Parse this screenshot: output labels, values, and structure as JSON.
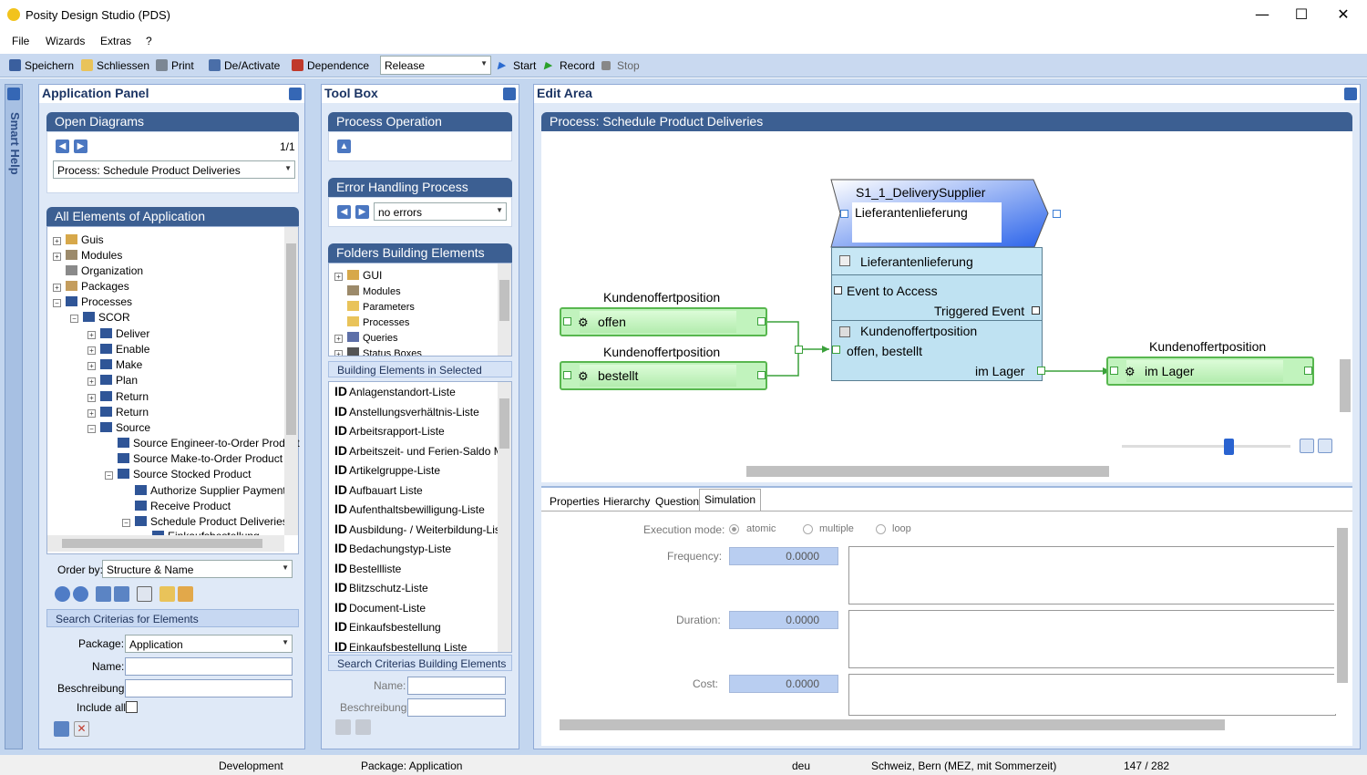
{
  "window": {
    "title": "Posity Design Studio (PDS)",
    "minimize": "—",
    "maximize": "☐",
    "close": "✕"
  },
  "menu": [
    "File",
    "Wizards",
    "Extras",
    "?"
  ],
  "toolbar": {
    "save": "Speichern",
    "close": "Schliessen",
    "print": "Print",
    "activate": "De/Activate",
    "dependence": "Dependence",
    "mode_value": "Release",
    "start": "Start",
    "record": "Record",
    "stop": "Stop"
  },
  "smart_help": "Smart Help",
  "app_panel": {
    "title": "Application Panel",
    "open_diagrams": "Open Diagrams",
    "page": "1/1",
    "diagram_select": "Process: Schedule Product Deliveries",
    "all_elements": "All Elements of Application",
    "tree": [
      "Guis",
      "Modules",
      "Organization",
      "Packages",
      "Processes",
      "SCOR",
      "Deliver",
      "Enable",
      "Make",
      "Plan",
      "Return",
      "Return",
      "Source",
      "Source Engineer-to-Order Product",
      "Source Make-to-Order Product",
      "Source Stocked Product",
      "Authorize Supplier Payment",
      "Receive Product",
      "Schedule Product Deliveries",
      "Einkaufsbestellung"
    ],
    "order_by_label": "Order by:",
    "order_by_value": "Structure & Name",
    "search_header": "Search Criterias for Elements",
    "package_label": "Package:",
    "package_value": "Application",
    "name_label": "Name:",
    "desc_label": "Beschreibung:",
    "include_all_label": "Include all"
  },
  "toolbox": {
    "title": "Tool Box",
    "process_operation": "Process Operation",
    "error_handling": "Error Handling Process",
    "error_value": "no errors",
    "folders": "Folders Building Elements",
    "folder_tree": [
      "GUI",
      "Modules",
      "Parameters",
      "Processes",
      "Queries",
      "Status Boxes"
    ],
    "building_elements": "Building Elements in Selected Folder",
    "id_prefix": "ID",
    "elements": [
      "Anlagenstandort-Liste",
      "Anstellungsverhältnis-Liste",
      "Arbeitsrapport-Liste",
      "Arbeitszeit- und Ferien-Saldo Mit",
      "Artikelgruppe-Liste",
      "Aufbauart Liste",
      "Aufenthaltsbewilligung-Liste",
      "Ausbildung- / Weiterbildung-Liste",
      "Bedachungstyp-Liste",
      "Bestellliste",
      "Blitzschutz-Liste",
      "Document-Liste",
      "Einkaufsbestellung",
      "Einkaufsbestellung Liste"
    ],
    "search_header": "Search Criterias Building Elements",
    "name_label": "Name:",
    "desc_label": "Beschreibung:"
  },
  "edit_area": {
    "title": "Edit Area",
    "process_header": "Process: Schedule Product Deliveries",
    "diagram": {
      "supplier_title": "S1_1_DeliverySupplier",
      "supplier_input": "Lieferantenlieferung",
      "op_name": "Lieferantenlieferung",
      "event_to_access": "Event to Access",
      "triggered_event": "Triggered Event",
      "op_param": "Kundenoffertposition",
      "op_in_status": "offen, bestellt",
      "op_out_status": "im Lager",
      "node1_title": "Kundenoffertposition",
      "node1_status": "offen",
      "node2_title": "Kundenoffertposition",
      "node2_status": "bestellt",
      "node3_title": "Kundenoffertposition",
      "node3_status": "im Lager"
    },
    "tabs": [
      "Properties",
      "Hierarchy",
      "Question",
      "Simulation"
    ],
    "active_tab": "Simulation",
    "sim": {
      "mode_label": "Execution mode:",
      "modes": [
        "atomic",
        "multiple",
        "loop"
      ],
      "selected_mode": "atomic",
      "frequency_label": "Frequency:",
      "frequency": "0.0000",
      "duration_label": "Duration:",
      "duration": "0.0000",
      "cost_label": "Cost:",
      "cost": "0.0000"
    }
  },
  "status": {
    "env": "Development",
    "package": "Package: Application",
    "lang": "deu",
    "tz": "Schweiz, Bern (MEZ, mit Sommerzeit)",
    "count": "147 / 282"
  },
  "colors": {
    "accent": "#3c5f92",
    "node_green": "#c1f3bd",
    "op_blue": "#bfe2f2"
  }
}
